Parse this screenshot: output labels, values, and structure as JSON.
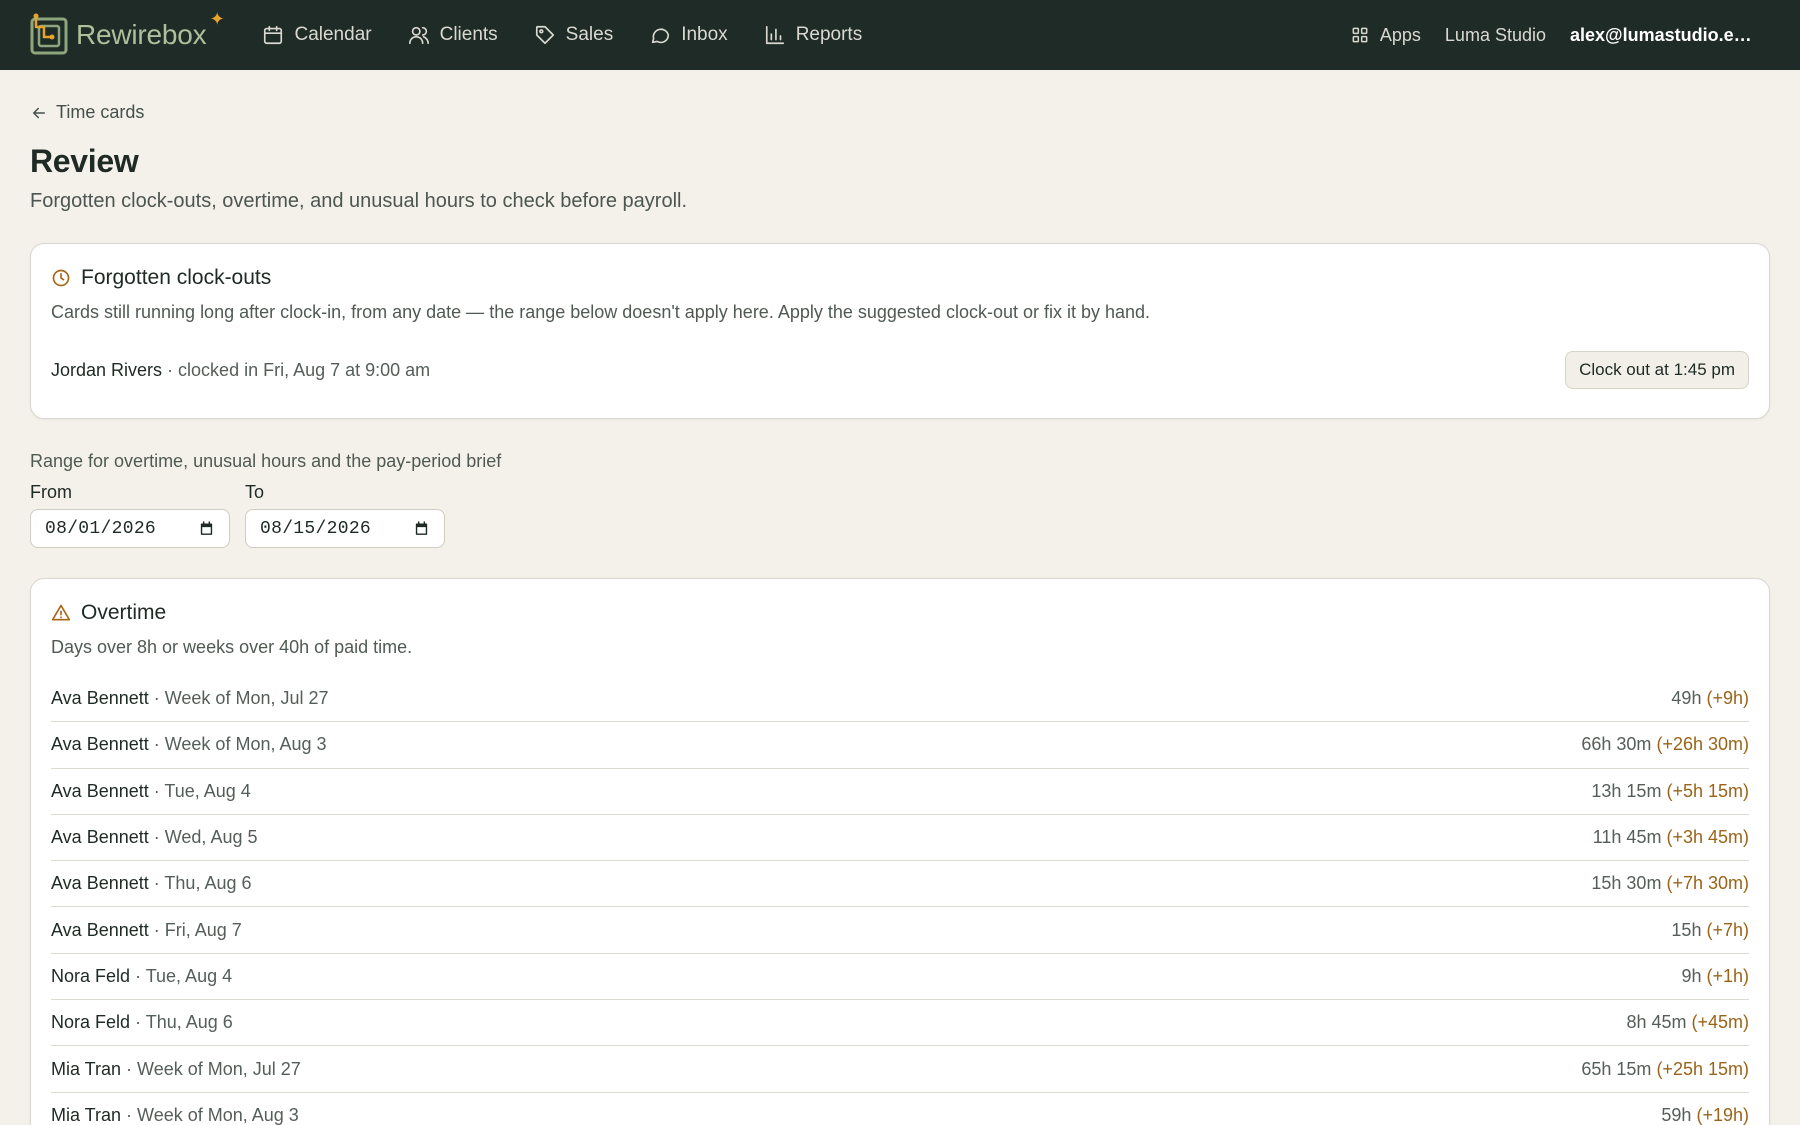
{
  "brand": {
    "name": "Rewirebox"
  },
  "nav": [
    {
      "label": "Calendar",
      "icon": "calendar-icon"
    },
    {
      "label": "Clients",
      "icon": "clients-icon"
    },
    {
      "label": "Sales",
      "icon": "tag-icon"
    },
    {
      "label": "Inbox",
      "icon": "chat-bubble-icon"
    },
    {
      "label": "Reports",
      "icon": "bar-chart-icon"
    }
  ],
  "topbar_right": {
    "apps_label": "Apps",
    "studio": "Luma Studio",
    "account": "alex@lumastudio.exam..."
  },
  "back_link": "Time cards",
  "page": {
    "title": "Review",
    "subtitle": "Forgotten clock-outs, overtime, and unusual hours to check before payroll."
  },
  "forgotten": {
    "title": "Forgotten clock-outs",
    "description": "Cards still running long after clock-in, from any date — the range below doesn't apply here. Apply the suggested clock-out or fix it by hand.",
    "rows": [
      {
        "name": "Jordan Rivers",
        "meta": " · clocked in Fri, Aug 7 at 9:00 am",
        "action": "Clock out at 1:45 pm"
      }
    ]
  },
  "range": {
    "label": "Range for overtime, unusual hours and the pay-period brief",
    "from_label": "From",
    "from_value": "08/01/2026",
    "to_label": "To",
    "to_value": "08/15/2026"
  },
  "overtime": {
    "title": "Overtime",
    "description": "Days over 8h or weeks over 40h of paid time.",
    "rows": [
      {
        "name": "Ava Bennett",
        "when": " · Week of Mon, Jul 27",
        "total": "49h ",
        "extra": "(+9h)"
      },
      {
        "name": "Ava Bennett",
        "when": " · Week of Mon, Aug 3",
        "total": "66h 30m ",
        "extra": "(+26h 30m)"
      },
      {
        "name": "Ava Bennett",
        "when": " · Tue, Aug 4",
        "total": "13h 15m ",
        "extra": "(+5h 15m)"
      },
      {
        "name": "Ava Bennett",
        "when": " · Wed, Aug 5",
        "total": "11h 45m ",
        "extra": "(+3h 45m)"
      },
      {
        "name": "Ava Bennett",
        "when": " · Thu, Aug 6",
        "total": "15h 30m ",
        "extra": "(+7h 30m)"
      },
      {
        "name": "Ava Bennett",
        "when": " · Fri, Aug 7",
        "total": "15h ",
        "extra": "(+7h)"
      },
      {
        "name": "Nora Feld",
        "when": " · Tue, Aug 4",
        "total": "9h ",
        "extra": "(+1h)"
      },
      {
        "name": "Nora Feld",
        "when": " · Thu, Aug 6",
        "total": "8h 45m ",
        "extra": "(+45m)"
      },
      {
        "name": "Mia Tran",
        "when": " · Week of Mon, Jul 27",
        "total": "65h 15m ",
        "extra": "(+25h 15m)"
      },
      {
        "name": "Mia Tran",
        "when": " · Week of Mon, Aug 3",
        "total": "59h ",
        "extra": "(+19h)"
      }
    ]
  },
  "colors": {
    "topbar_bg": "#1f2b26",
    "page_bg": "#f3f1ea",
    "accent_amber": "#9a6418",
    "brand_green": "#aebf9b",
    "sparkle": "#e6a42c"
  }
}
